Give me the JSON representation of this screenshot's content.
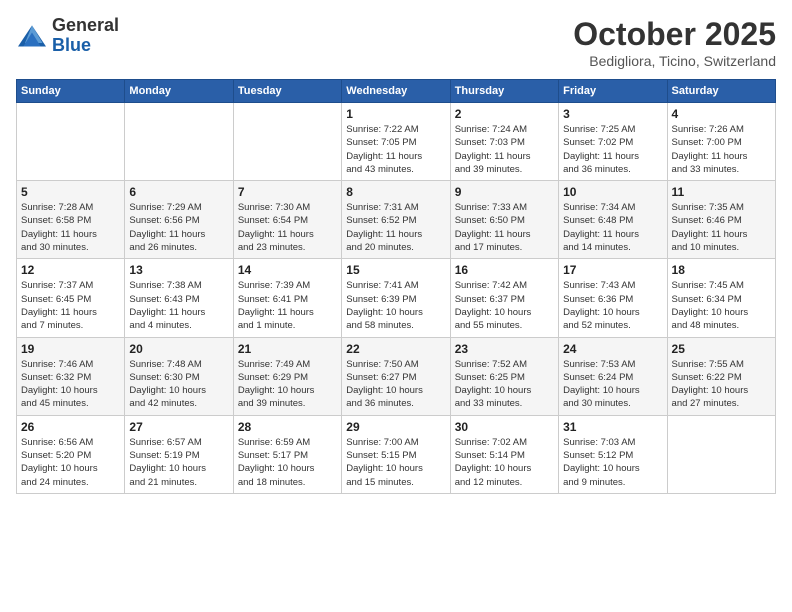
{
  "header": {
    "logo_general": "General",
    "logo_blue": "Blue",
    "month": "October 2025",
    "location": "Bedigliora, Ticino, Switzerland"
  },
  "weekdays": [
    "Sunday",
    "Monday",
    "Tuesday",
    "Wednesday",
    "Thursday",
    "Friday",
    "Saturday"
  ],
  "weeks": [
    [
      {
        "day": "",
        "info": ""
      },
      {
        "day": "",
        "info": ""
      },
      {
        "day": "",
        "info": ""
      },
      {
        "day": "1",
        "info": "Sunrise: 7:22 AM\nSunset: 7:05 PM\nDaylight: 11 hours\nand 43 minutes."
      },
      {
        "day": "2",
        "info": "Sunrise: 7:24 AM\nSunset: 7:03 PM\nDaylight: 11 hours\nand 39 minutes."
      },
      {
        "day": "3",
        "info": "Sunrise: 7:25 AM\nSunset: 7:02 PM\nDaylight: 11 hours\nand 36 minutes."
      },
      {
        "day": "4",
        "info": "Sunrise: 7:26 AM\nSunset: 7:00 PM\nDaylight: 11 hours\nand 33 minutes."
      }
    ],
    [
      {
        "day": "5",
        "info": "Sunrise: 7:28 AM\nSunset: 6:58 PM\nDaylight: 11 hours\nand 30 minutes."
      },
      {
        "day": "6",
        "info": "Sunrise: 7:29 AM\nSunset: 6:56 PM\nDaylight: 11 hours\nand 26 minutes."
      },
      {
        "day": "7",
        "info": "Sunrise: 7:30 AM\nSunset: 6:54 PM\nDaylight: 11 hours\nand 23 minutes."
      },
      {
        "day": "8",
        "info": "Sunrise: 7:31 AM\nSunset: 6:52 PM\nDaylight: 11 hours\nand 20 minutes."
      },
      {
        "day": "9",
        "info": "Sunrise: 7:33 AM\nSunset: 6:50 PM\nDaylight: 11 hours\nand 17 minutes."
      },
      {
        "day": "10",
        "info": "Sunrise: 7:34 AM\nSunset: 6:48 PM\nDaylight: 11 hours\nand 14 minutes."
      },
      {
        "day": "11",
        "info": "Sunrise: 7:35 AM\nSunset: 6:46 PM\nDaylight: 11 hours\nand 10 minutes."
      }
    ],
    [
      {
        "day": "12",
        "info": "Sunrise: 7:37 AM\nSunset: 6:45 PM\nDaylight: 11 hours\nand 7 minutes."
      },
      {
        "day": "13",
        "info": "Sunrise: 7:38 AM\nSunset: 6:43 PM\nDaylight: 11 hours\nand 4 minutes."
      },
      {
        "day": "14",
        "info": "Sunrise: 7:39 AM\nSunset: 6:41 PM\nDaylight: 11 hours\nand 1 minute."
      },
      {
        "day": "15",
        "info": "Sunrise: 7:41 AM\nSunset: 6:39 PM\nDaylight: 10 hours\nand 58 minutes."
      },
      {
        "day": "16",
        "info": "Sunrise: 7:42 AM\nSunset: 6:37 PM\nDaylight: 10 hours\nand 55 minutes."
      },
      {
        "day": "17",
        "info": "Sunrise: 7:43 AM\nSunset: 6:36 PM\nDaylight: 10 hours\nand 52 minutes."
      },
      {
        "day": "18",
        "info": "Sunrise: 7:45 AM\nSunset: 6:34 PM\nDaylight: 10 hours\nand 48 minutes."
      }
    ],
    [
      {
        "day": "19",
        "info": "Sunrise: 7:46 AM\nSunset: 6:32 PM\nDaylight: 10 hours\nand 45 minutes."
      },
      {
        "day": "20",
        "info": "Sunrise: 7:48 AM\nSunset: 6:30 PM\nDaylight: 10 hours\nand 42 minutes."
      },
      {
        "day": "21",
        "info": "Sunrise: 7:49 AM\nSunset: 6:29 PM\nDaylight: 10 hours\nand 39 minutes."
      },
      {
        "day": "22",
        "info": "Sunrise: 7:50 AM\nSunset: 6:27 PM\nDaylight: 10 hours\nand 36 minutes."
      },
      {
        "day": "23",
        "info": "Sunrise: 7:52 AM\nSunset: 6:25 PM\nDaylight: 10 hours\nand 33 minutes."
      },
      {
        "day": "24",
        "info": "Sunrise: 7:53 AM\nSunset: 6:24 PM\nDaylight: 10 hours\nand 30 minutes."
      },
      {
        "day": "25",
        "info": "Sunrise: 7:55 AM\nSunset: 6:22 PM\nDaylight: 10 hours\nand 27 minutes."
      }
    ],
    [
      {
        "day": "26",
        "info": "Sunrise: 6:56 AM\nSunset: 5:20 PM\nDaylight: 10 hours\nand 24 minutes."
      },
      {
        "day": "27",
        "info": "Sunrise: 6:57 AM\nSunset: 5:19 PM\nDaylight: 10 hours\nand 21 minutes."
      },
      {
        "day": "28",
        "info": "Sunrise: 6:59 AM\nSunset: 5:17 PM\nDaylight: 10 hours\nand 18 minutes."
      },
      {
        "day": "29",
        "info": "Sunrise: 7:00 AM\nSunset: 5:15 PM\nDaylight: 10 hours\nand 15 minutes."
      },
      {
        "day": "30",
        "info": "Sunrise: 7:02 AM\nSunset: 5:14 PM\nDaylight: 10 hours\nand 12 minutes."
      },
      {
        "day": "31",
        "info": "Sunrise: 7:03 AM\nSunset: 5:12 PM\nDaylight: 10 hours\nand 9 minutes."
      },
      {
        "day": "",
        "info": ""
      }
    ]
  ]
}
